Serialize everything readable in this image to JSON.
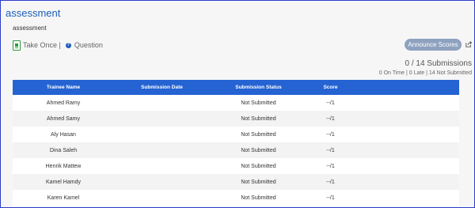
{
  "header": {
    "title": "assessment",
    "subtitle": "assessment",
    "take_once": "Take Once |",
    "question": "Question"
  },
  "actions": {
    "announce_label": "Announce Scores"
  },
  "summary": {
    "submissions": "0 / 14 Submissions",
    "stats": "0 On Time | 0 Late | 14 Not Submitted"
  },
  "table": {
    "headers": [
      "Trainee Name",
      "Submission Date",
      "Submission Status",
      "Score"
    ],
    "rows": [
      {
        "name": "Ahmed Ramy",
        "date": "",
        "status": "Not Submitted",
        "score": "--/1"
      },
      {
        "name": "Ahmed Samy",
        "date": "",
        "status": "Not Submitted",
        "score": "--/1"
      },
      {
        "name": "Aly Hasan",
        "date": "",
        "status": "Not Submitted",
        "score": "--/1"
      },
      {
        "name": "Dina Saleh",
        "date": "",
        "status": "Not Submitted",
        "score": "--/1"
      },
      {
        "name": "Henrik Mattew",
        "date": "",
        "status": "Not Submitted",
        "score": "--/1"
      },
      {
        "name": "Kamel Hamdy",
        "date": "",
        "status": "Not Submitted",
        "score": "--/1"
      },
      {
        "name": "Karen Kamel",
        "date": "",
        "status": "Not Submitted",
        "score": "--/1"
      }
    ]
  },
  "colors": {
    "accent": "#2563d3",
    "title": "#1c5fb8",
    "button": "#8ea1bf",
    "icon_green": "#2e9a3f"
  }
}
